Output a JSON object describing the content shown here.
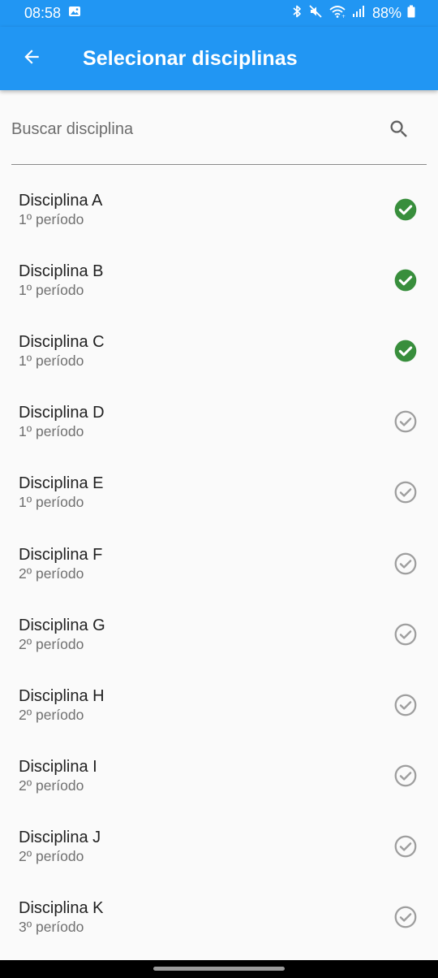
{
  "status_bar": {
    "time": "08:58",
    "battery": "88%",
    "icons": [
      "image-icon",
      "bluetooth-icon",
      "mute-icon",
      "wifi-icon",
      "signal-icon",
      "battery-icon"
    ]
  },
  "app_bar": {
    "title": "Selecionar disciplinas",
    "back_icon": "arrow-back-icon",
    "color": "#2196f3"
  },
  "search": {
    "placeholder": "Buscar disciplina",
    "value": "",
    "icon": "search-icon"
  },
  "colors": {
    "selected": "#388e3c",
    "unselected": "#9e9e9e"
  },
  "disciplines": [
    {
      "name": "Disciplina A",
      "period": "1º período",
      "selected": true
    },
    {
      "name": "Disciplina B",
      "period": "1º período",
      "selected": true
    },
    {
      "name": "Disciplina C",
      "period": "1º período",
      "selected": true
    },
    {
      "name": "Disciplina D",
      "period": "1º período",
      "selected": false
    },
    {
      "name": "Disciplina E",
      "period": "1º período",
      "selected": false
    },
    {
      "name": "Disciplina F",
      "period": "2º período",
      "selected": false
    },
    {
      "name": "Disciplina G",
      "period": "2º período",
      "selected": false
    },
    {
      "name": "Disciplina H",
      "period": "2º período",
      "selected": false
    },
    {
      "name": "Disciplina I",
      "period": "2º período",
      "selected": false
    },
    {
      "name": "Disciplina J",
      "period": "2º período",
      "selected": false
    },
    {
      "name": "Disciplina K",
      "period": "3º período",
      "selected": false
    }
  ]
}
